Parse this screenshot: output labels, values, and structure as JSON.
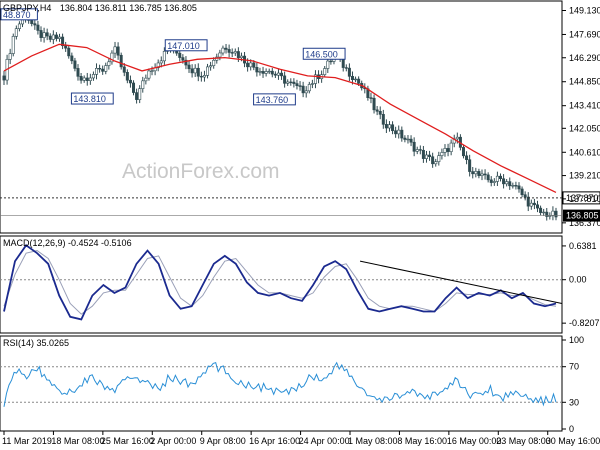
{
  "chart_data": [
    {
      "type": "candlestick",
      "panel": "price",
      "symbol": "GBPJPY,H4",
      "header_values": "136.804 136.811 136.785 136.805",
      "watermark": "ActionForex.com",
      "ylim": [
        136.0,
        149.4
      ],
      "y_ticks": [
        "149.130",
        "147.690",
        "146.290",
        "144.850",
        "143.410",
        "142.050",
        "140.610",
        "139.210",
        "137.810",
        "136.370"
      ],
      "y_tick_values": [
        149.13,
        147.69,
        146.29,
        144.85,
        143.41,
        142.05,
        140.61,
        139.21,
        137.81,
        136.37
      ],
      "x_ticks": [
        "11 Mar 2019",
        "18 Mar 08:00",
        "25 Mar 16:00",
        "2 Apr 00:00",
        "9 Apr 08:00",
        "16 Apr 16:00",
        "24 Apr 00:00",
        "1 May 08:00",
        "8 May 16:00",
        "16 May 00:00",
        "23 May 08:00",
        "30 May 16:00"
      ],
      "current_price_label": "136.805",
      "current_price": 136.805,
      "support_line": {
        "label": "137.870",
        "value": 137.87,
        "style": "dotted"
      },
      "annotations": [
        {
          "text": "48.870",
          "x_frac": 0.005,
          "value": 148.87
        },
        {
          "text": "143.810",
          "x_frac": 0.16,
          "value": 143.81
        },
        {
          "text": "147.010",
          "x_frac": 0.33,
          "value": 147.01
        },
        {
          "text": "146.500",
          "x_frac": 0.58,
          "value": 146.5
        },
        {
          "text": "143.760",
          "x_frac": 0.49,
          "value": 143.76
        }
      ],
      "close_path": [
        [
          0.0,
          145.2
        ],
        [
          0.02,
          148.0
        ],
        [
          0.04,
          148.87
        ],
        [
          0.06,
          147.8
        ],
        [
          0.08,
          147.4
        ],
        [
          0.1,
          147.5
        ],
        [
          0.12,
          146.2
        ],
        [
          0.14,
          145.0
        ],
        [
          0.16,
          145.3
        ],
        [
          0.18,
          145.6
        ],
        [
          0.2,
          146.8
        ],
        [
          0.22,
          145.1
        ],
        [
          0.24,
          143.9
        ],
        [
          0.26,
          145.4
        ],
        [
          0.28,
          146.1
        ],
        [
          0.3,
          146.9
        ],
        [
          0.32,
          146.4
        ],
        [
          0.34,
          145.6
        ],
        [
          0.36,
          145.3
        ],
        [
          0.38,
          146.2
        ],
        [
          0.4,
          147.0
        ],
        [
          0.42,
          146.6
        ],
        [
          0.44,
          146.0
        ],
        [
          0.46,
          145.6
        ],
        [
          0.48,
          145.5
        ],
        [
          0.5,
          145.1
        ],
        [
          0.52,
          144.7
        ],
        [
          0.54,
          144.3
        ],
        [
          0.56,
          144.9
        ],
        [
          0.58,
          145.6
        ],
        [
          0.6,
          146.5
        ],
        [
          0.62,
          145.6
        ],
        [
          0.64,
          144.9
        ],
        [
          0.66,
          143.9
        ],
        [
          0.68,
          142.7
        ],
        [
          0.7,
          142.1
        ],
        [
          0.72,
          141.6
        ],
        [
          0.74,
          141.0
        ],
        [
          0.76,
          140.4
        ],
        [
          0.78,
          140.0
        ],
        [
          0.8,
          140.7
        ],
        [
          0.82,
          141.4
        ],
        [
          0.84,
          139.8
        ],
        [
          0.86,
          139.2
        ],
        [
          0.88,
          138.9
        ],
        [
          0.9,
          139.0
        ],
        [
          0.92,
          138.7
        ],
        [
          0.93,
          138.4
        ],
        [
          0.95,
          137.6
        ],
        [
          0.97,
          137.0
        ],
        [
          1.0,
          136.8
        ]
      ],
      "moving_average": [
        [
          0.0,
          145.5
        ],
        [
          0.05,
          146.4
        ],
        [
          0.1,
          147.1
        ],
        [
          0.15,
          146.9
        ],
        [
          0.2,
          146.1
        ],
        [
          0.25,
          145.5
        ],
        [
          0.3,
          145.9
        ],
        [
          0.35,
          146.2
        ],
        [
          0.4,
          146.3
        ],
        [
          0.45,
          146.1
        ],
        [
          0.5,
          145.6
        ],
        [
          0.55,
          145.2
        ],
        [
          0.6,
          145.1
        ],
        [
          0.65,
          144.6
        ],
        [
          0.7,
          143.5
        ],
        [
          0.75,
          142.6
        ],
        [
          0.8,
          141.7
        ],
        [
          0.85,
          140.7
        ],
        [
          0.9,
          139.8
        ],
        [
          0.95,
          139.0
        ],
        [
          1.0,
          138.2
        ]
      ]
    },
    {
      "type": "line",
      "panel": "macd",
      "title": "MACD(12,26,9) -0.4524 -0.5106",
      "ylim": [
        -0.95,
        0.75
      ],
      "y_ticks": [
        "0.6381",
        "0.00",
        "-0.8207"
      ],
      "y_tick_values": [
        0.6381,
        0.0,
        -0.8207
      ],
      "zero_line": 0.0,
      "series": [
        {
          "name": "MACD",
          "color": "#1b2a8f",
          "values": [
            [
              0.0,
              -0.6
            ],
            [
              0.02,
              0.35
            ],
            [
              0.04,
              0.65
            ],
            [
              0.06,
              0.5
            ],
            [
              0.08,
              0.3
            ],
            [
              0.1,
              -0.3
            ],
            [
              0.12,
              -0.7
            ],
            [
              0.14,
              -0.75
            ],
            [
              0.16,
              -0.3
            ],
            [
              0.18,
              -0.1
            ],
            [
              0.2,
              -0.25
            ],
            [
              0.22,
              -0.15
            ],
            [
              0.24,
              0.3
            ],
            [
              0.26,
              0.55
            ],
            [
              0.28,
              0.3
            ],
            [
              0.3,
              -0.3
            ],
            [
              0.32,
              -0.55
            ],
            [
              0.34,
              -0.5
            ],
            [
              0.36,
              -0.1
            ],
            [
              0.38,
              0.3
            ],
            [
              0.4,
              0.45
            ],
            [
              0.42,
              0.3
            ],
            [
              0.44,
              -0.05
            ],
            [
              0.46,
              -0.25
            ],
            [
              0.48,
              -0.3
            ],
            [
              0.5,
              -0.25
            ],
            [
              0.52,
              -0.35
            ],
            [
              0.54,
              -0.4
            ],
            [
              0.56,
              -0.1
            ],
            [
              0.58,
              0.25
            ],
            [
              0.6,
              0.35
            ],
            [
              0.62,
              0.2
            ],
            [
              0.64,
              -0.2
            ],
            [
              0.66,
              -0.55
            ],
            [
              0.68,
              -0.6
            ],
            [
              0.7,
              -0.55
            ],
            [
              0.72,
              -0.5
            ],
            [
              0.74,
              -0.55
            ],
            [
              0.76,
              -0.6
            ],
            [
              0.78,
              -0.6
            ],
            [
              0.8,
              -0.35
            ],
            [
              0.82,
              -0.15
            ],
            [
              0.84,
              -0.35
            ],
            [
              0.86,
              -0.25
            ],
            [
              0.88,
              -0.3
            ],
            [
              0.9,
              -0.2
            ],
            [
              0.92,
              -0.35
            ],
            [
              0.94,
              -0.25
            ],
            [
              0.96,
              -0.45
            ],
            [
              0.98,
              -0.5
            ],
            [
              1.0,
              -0.45
            ]
          ]
        },
        {
          "name": "Signal",
          "color": "#9aa0b8",
          "values": [
            [
              0.0,
              -0.5
            ],
            [
              0.02,
              0.1
            ],
            [
              0.04,
              0.5
            ],
            [
              0.06,
              0.55
            ],
            [
              0.08,
              0.4
            ],
            [
              0.1,
              0.0
            ],
            [
              0.12,
              -0.45
            ],
            [
              0.14,
              -0.65
            ],
            [
              0.16,
              -0.5
            ],
            [
              0.18,
              -0.25
            ],
            [
              0.2,
              -0.2
            ],
            [
              0.22,
              -0.2
            ],
            [
              0.24,
              0.1
            ],
            [
              0.26,
              0.4
            ],
            [
              0.28,
              0.45
            ],
            [
              0.3,
              0.05
            ],
            [
              0.32,
              -0.35
            ],
            [
              0.34,
              -0.5
            ],
            [
              0.36,
              -0.3
            ],
            [
              0.38,
              0.05
            ],
            [
              0.4,
              0.35
            ],
            [
              0.42,
              0.4
            ],
            [
              0.44,
              0.15
            ],
            [
              0.46,
              -0.1
            ],
            [
              0.48,
              -0.25
            ],
            [
              0.5,
              -0.25
            ],
            [
              0.52,
              -0.3
            ],
            [
              0.54,
              -0.35
            ],
            [
              0.56,
              -0.25
            ],
            [
              0.58,
              0.05
            ],
            [
              0.6,
              0.25
            ],
            [
              0.62,
              0.3
            ],
            [
              0.64,
              0.0
            ],
            [
              0.66,
              -0.35
            ],
            [
              0.68,
              -0.5
            ],
            [
              0.7,
              -0.55
            ],
            [
              0.72,
              -0.5
            ],
            [
              0.74,
              -0.5
            ],
            [
              0.76,
              -0.55
            ],
            [
              0.78,
              -0.6
            ],
            [
              0.8,
              -0.45
            ],
            [
              0.82,
              -0.25
            ],
            [
              0.84,
              -0.28
            ],
            [
              0.86,
              -0.28
            ],
            [
              0.88,
              -0.28
            ],
            [
              0.9,
              -0.25
            ],
            [
              0.92,
              -0.3
            ],
            [
              0.94,
              -0.28
            ],
            [
              0.96,
              -0.38
            ],
            [
              0.98,
              -0.47
            ],
            [
              1.0,
              -0.5
            ]
          ]
        }
      ],
      "trendline": {
        "from": [
          0.645,
          0.35
        ],
        "to": [
          1.0,
          -0.45
        ],
        "color": "#000000"
      }
    },
    {
      "type": "line",
      "panel": "rsi",
      "title": "RSI(14) 35.0265",
      "ylim": [
        0,
        100
      ],
      "y_ticks": [
        "100",
        "70",
        "30",
        "0"
      ],
      "y_tick_values": [
        100,
        70,
        30,
        0
      ],
      "levels": [
        70,
        30
      ],
      "series": [
        {
          "name": "RSI(14)",
          "color": "#2a8fd6",
          "values": [
            [
              0.0,
              30
            ],
            [
              0.02,
              65
            ],
            [
              0.04,
              60
            ],
            [
              0.06,
              68
            ],
            [
              0.08,
              55
            ],
            [
              0.1,
              45
            ],
            [
              0.12,
              40
            ],
            [
              0.14,
              52
            ],
            [
              0.16,
              58
            ],
            [
              0.18,
              48
            ],
            [
              0.2,
              42
            ],
            [
              0.22,
              55
            ],
            [
              0.24,
              60
            ],
            [
              0.26,
              50
            ],
            [
              0.28,
              45
            ],
            [
              0.3,
              58
            ],
            [
              0.32,
              55
            ],
            [
              0.34,
              48
            ],
            [
              0.36,
              62
            ],
            [
              0.38,
              72
            ],
            [
              0.4,
              65
            ],
            [
              0.42,
              55
            ],
            [
              0.44,
              50
            ],
            [
              0.46,
              48
            ],
            [
              0.48,
              45
            ],
            [
              0.5,
              40
            ],
            [
              0.52,
              42
            ],
            [
              0.54,
              52
            ],
            [
              0.56,
              60
            ],
            [
              0.58,
              55
            ],
            [
              0.6,
              72
            ],
            [
              0.62,
              65
            ],
            [
              0.64,
              50
            ],
            [
              0.66,
              38
            ],
            [
              0.68,
              30
            ],
            [
              0.7,
              35
            ],
            [
              0.72,
              40
            ],
            [
              0.74,
              42
            ],
            [
              0.76,
              32
            ],
            [
              0.78,
              40
            ],
            [
              0.8,
              45
            ],
            [
              0.82,
              55
            ],
            [
              0.84,
              40
            ],
            [
              0.86,
              38
            ],
            [
              0.88,
              45
            ],
            [
              0.9,
              35
            ],
            [
              0.92,
              40
            ],
            [
              0.94,
              42
            ],
            [
              0.96,
              30
            ],
            [
              0.98,
              32
            ],
            [
              1.0,
              35
            ]
          ]
        }
      ]
    }
  ]
}
